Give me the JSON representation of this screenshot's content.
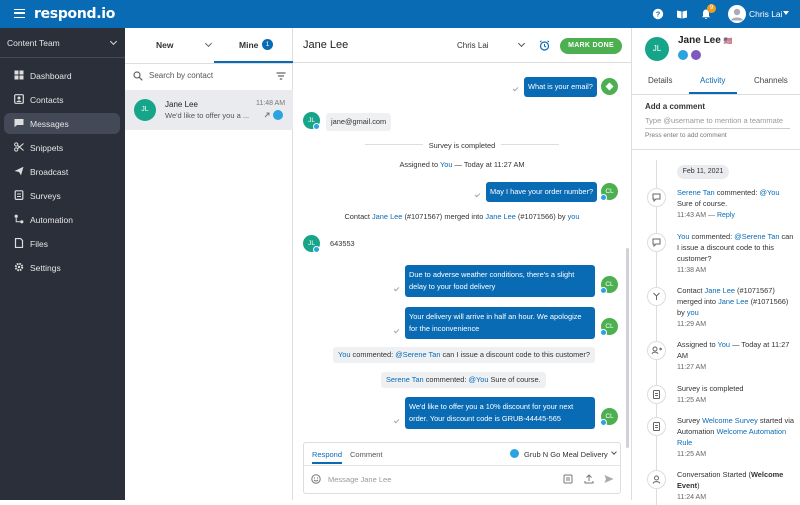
{
  "topbar": {
    "logo": "respond.io",
    "notification_count": "9",
    "user_name": "Chris Lai"
  },
  "sidebar": {
    "workspace": "Content Team",
    "items": [
      {
        "label": "Dashboard",
        "icon": "dashboard-icon"
      },
      {
        "label": "Contacts",
        "icon": "contacts-icon"
      },
      {
        "label": "Messages",
        "icon": "messages-icon"
      },
      {
        "label": "Snippets",
        "icon": "snippets-icon"
      },
      {
        "label": "Broadcast",
        "icon": "broadcast-icon"
      },
      {
        "label": "Surveys",
        "icon": "surveys-icon"
      },
      {
        "label": "Automation",
        "icon": "automation-icon"
      },
      {
        "label": "Files",
        "icon": "files-icon"
      },
      {
        "label": "Settings",
        "icon": "settings-icon"
      }
    ],
    "active_index": 2
  },
  "conversations": {
    "tab_new": "New",
    "tab_mine": "Mine",
    "mine_count": "1",
    "search_placeholder": "Search by contact",
    "items": [
      {
        "initials": "JL",
        "name": "Jane Lee",
        "time": "11:48 AM",
        "preview": "We'd like to offer you a ..."
      }
    ]
  },
  "chat": {
    "contact_name": "Jane Lee",
    "assignee": "Chris Lai",
    "mark_done": "MARK DONE",
    "messages": {
      "m1": "What is your email?",
      "m2": "jane@gmail.com",
      "sys1": "Survey is completed",
      "sys2_a": "Assigned to ",
      "sys2_b": "You",
      "sys2_c": " — Today at 11:27 AM",
      "m3": "May I have your order number?",
      "merge_a": "Contact ",
      "merge_b": "Jane  Lee",
      "merge_c": " (#1071567) merged into ",
      "merge_d": "Jane Lee",
      "merge_e": " (#1071566) by ",
      "merge_f": "you",
      "m4": "643553",
      "m5": "Due to adverse weather conditions, there's a slight delay to your food delivery",
      "m6": "Your delivery will arrive in half an hour. We apologize for the inconvenience",
      "c1_a": "You",
      "c1_b": " commented: ",
      "c1_c": "@Serene Tan",
      "c1_d": " can I issue a discount code to this customer?",
      "c2_a": "Serene Tan",
      "c2_b": " commented: ",
      "c2_c": "@You",
      "c2_d": " Sure of course.",
      "m7": "We'd like to offer you a 10% discount for your next order. Your discount code is GRUB-44445-565"
    },
    "compose": {
      "tab_respond": "Respond",
      "tab_comment": "Comment",
      "channel": "Grub N Go Meal Delivery",
      "placeholder": "Message Jane Lee"
    },
    "initials_contact": "JL",
    "initials_agent": "CL"
  },
  "contact_panel": {
    "initials": "JL",
    "name": "Jane Lee",
    "flag": "🇺🇸",
    "tabs": [
      "Details",
      "Activity",
      "Channels"
    ],
    "active_tab": 1,
    "add_comment": "Add a comment",
    "comment_placeholder": "Type @username to mention a teammate",
    "hint": "Press enter to add comment",
    "date": "Feb 11, 2021",
    "activity": {
      "a1_user": "Serene Tan",
      "a1_rest": " commented: ",
      "a1_mention": "@You",
      "a1_text": " Sure of course.",
      "a1_time": "11:43 AM",
      "a1_sep": " — ",
      "a1_reply": "Reply",
      "a2_user": "You",
      "a2_rest": " commented: ",
      "a2_mention": "@Serene Tan",
      "a2_text": " can I issue a discount code to this customer?",
      "a2_time": "11:38 AM",
      "a3_a": "Contact ",
      "a3_b": "Jane  Lee",
      "a3_c": " (#1071567) merged into ",
      "a3_d": "Jane Lee",
      "a3_e": " (#1071566) by ",
      "a3_f": "you",
      "a3_time": "11:29 AM",
      "a4_a": "Assigned to ",
      "a4_b": "You",
      "a4_c": " — Today at 11:27 AM",
      "a4_time": "11:27 AM",
      "a5_text": "Survey is completed",
      "a5_time": "11:25 AM",
      "a6_a": "Survey ",
      "a6_b": "Welcome Survey",
      "a6_c": " started via Automation ",
      "a6_d": "Welcome Automation Rule",
      "a6_time": "11:25 AM",
      "a7_a": "Conversation Started (",
      "a7_b": "Welcome Event",
      "a7_c": ")",
      "a7_time": "11:24 AM"
    }
  },
  "colors": {
    "brand": "#0a6bb5",
    "sidebar": "#2b2f3a",
    "done": "#4caf50",
    "avatar": "#17a589"
  }
}
